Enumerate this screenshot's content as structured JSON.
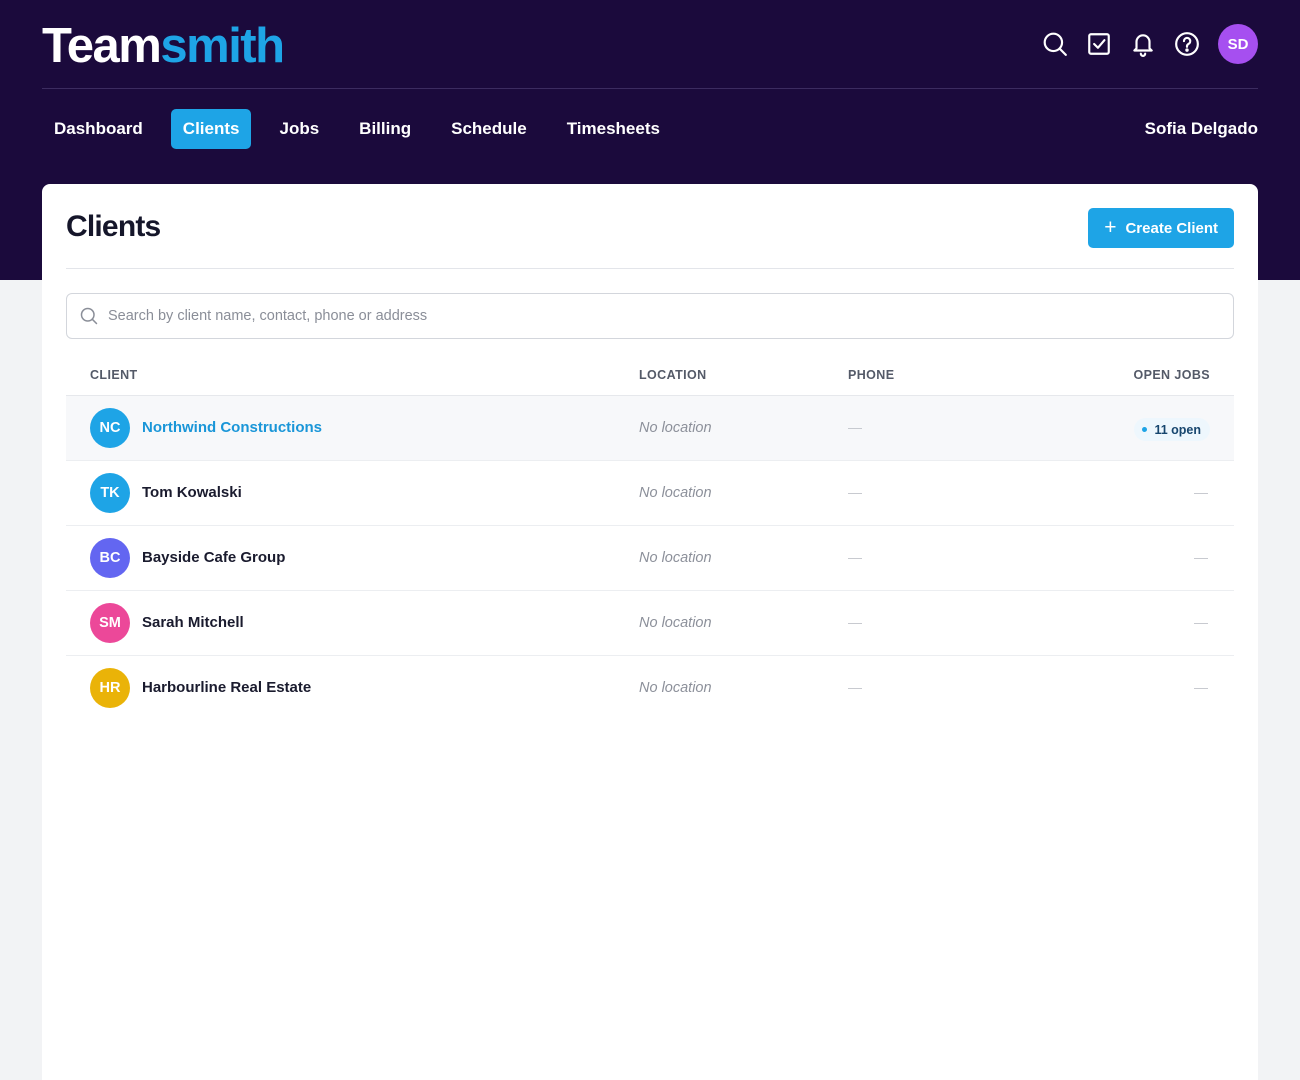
{
  "app": {
    "logo_part1": "Team",
    "logo_part2": "smith"
  },
  "header_icons": [
    "search-icon",
    "tasks-check-icon",
    "bell-icon",
    "help-icon"
  ],
  "user": {
    "initials": "SD",
    "name": "Sofia Delgado",
    "avatar_color": "#a64ff0"
  },
  "nav": {
    "items": [
      {
        "label": "Dashboard",
        "active": false
      },
      {
        "label": "Clients",
        "active": true
      },
      {
        "label": "Jobs",
        "active": false
      },
      {
        "label": "Billing",
        "active": false
      },
      {
        "label": "Schedule",
        "active": false
      },
      {
        "label": "Timesheets",
        "active": false
      }
    ]
  },
  "page": {
    "title": "Clients",
    "create_button": {
      "icon": "+",
      "label": "Create Client"
    }
  },
  "search": {
    "placeholder": "Search by client name, contact, phone or address",
    "value": ""
  },
  "table": {
    "columns": [
      "CLIENT",
      "LOCATION",
      "PHONE",
      "OPEN JOBS"
    ],
    "rows": [
      {
        "initials": "NC",
        "name": "Northwind Constructions",
        "avatar_color": "#1ea4e6",
        "location": "No location",
        "phone": "—",
        "open_jobs": "11 open"
      },
      {
        "initials": "TK",
        "name": "Tom Kowalski",
        "avatar_color": "#1ea4e6",
        "location": "No location",
        "phone": "—",
        "open_jobs": "—"
      },
      {
        "initials": "BC",
        "name": "Bayside Cafe Group",
        "avatar_color": "#6366f1",
        "location": "No location",
        "phone": "—",
        "open_jobs": "—"
      },
      {
        "initials": "SM",
        "name": "Sarah Mitchell",
        "avatar_color": "#ec4899",
        "location": "No location",
        "phone": "—",
        "open_jobs": "—"
      },
      {
        "initials": "HR",
        "name": "Harbourline Real Estate",
        "avatar_color": "#eab308",
        "location": "No location",
        "phone": "—",
        "open_jobs": "—"
      }
    ]
  },
  "colors": {
    "header_bg": "#1b0a3c",
    "accent": "#1ea4e6",
    "page_bg": "#f2f3f5"
  }
}
